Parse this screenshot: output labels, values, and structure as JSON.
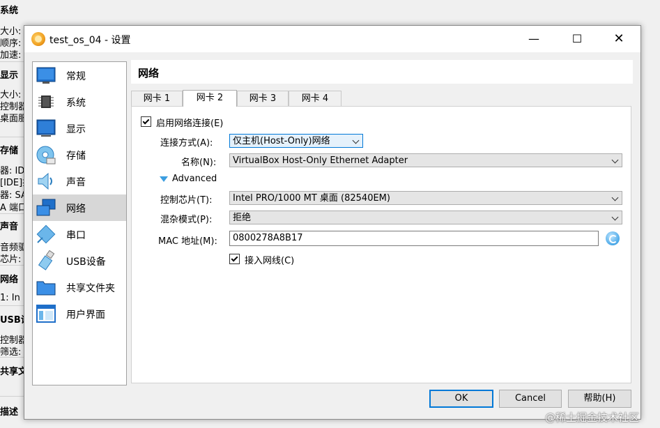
{
  "background_window": {
    "lines": [
      {
        "text": "系统",
        "bold": true
      },
      {
        "text": "大小:",
        "bold": false
      },
      {
        "text": "顺序:",
        "bold": false
      },
      {
        "text": "加速:",
        "bold": false
      },
      {
        "text": "显示",
        "bold": true
      },
      {
        "text": "大小:",
        "bold": false
      },
      {
        "text": "控制器",
        "bold": false
      },
      {
        "text": "桌面服",
        "bold": false
      },
      {
        "text": "存储",
        "bold": true
      },
      {
        "text": "器: ID",
        "bold": false
      },
      {
        "text": "[IDE]控",
        "bold": false
      },
      {
        "text": "器: SA",
        "bold": false
      },
      {
        "text": "A 端口",
        "bold": false
      },
      {
        "text": "声音",
        "bold": true
      },
      {
        "text": "音频驱",
        "bold": false
      },
      {
        "text": "芯片:",
        "bold": false
      },
      {
        "text": "网络",
        "bold": true
      },
      {
        "text": "1: In",
        "bold": false
      },
      {
        "text": "USB设",
        "bold": true
      },
      {
        "text": "控制器",
        "bold": false
      },
      {
        "text": "筛选:",
        "bold": false
      },
      {
        "text": "共享文",
        "bold": true
      },
      {
        "text": "描述",
        "bold": true
      }
    ]
  },
  "window": {
    "title": "test_os_04 - 设置",
    "minimize": "—",
    "maximize": "☐",
    "close": "✕"
  },
  "sidebar": {
    "items": [
      {
        "label": "常规",
        "icon": "general-icon"
      },
      {
        "label": "系统",
        "icon": "system-icon"
      },
      {
        "label": "显示",
        "icon": "display-icon"
      },
      {
        "label": "存储",
        "icon": "storage-icon"
      },
      {
        "label": "声音",
        "icon": "audio-icon"
      },
      {
        "label": "网络",
        "icon": "network-icon",
        "selected": true
      },
      {
        "label": "串口",
        "icon": "serial-port-icon"
      },
      {
        "label": "USB设备",
        "icon": "usb-icon"
      },
      {
        "label": "共享文件夹",
        "icon": "shared-folder-icon"
      },
      {
        "label": "用户界面",
        "icon": "user-interface-icon"
      }
    ]
  },
  "page": {
    "header": "网络",
    "tabs": [
      "网卡 1",
      "网卡 2",
      "网卡 3",
      "网卡 4"
    ],
    "active_tab": 1
  },
  "form": {
    "enable_label": "启用网络连接(E)",
    "enable_checked": true,
    "attached_label": "连接方式(A):",
    "attached_value": "仅主机(Host-Only)网络",
    "name_label": "名称(N):",
    "name_value": "VirtualBox Host-Only Ethernet Adapter",
    "advanced_label": "Advanced",
    "adapter_label": "控制芯片(T):",
    "adapter_value": "Intel PRO/1000 MT 桌面 (82540EM)",
    "promisc_label": "混杂模式(P):",
    "promisc_value": "拒绝",
    "mac_label": "MAC 地址(M):",
    "mac_value": "0800278A8B17",
    "cable_label": "接入网线(C)",
    "cable_checked": true
  },
  "buttons": {
    "ok": "OK",
    "cancel": "Cancel",
    "help": "帮助(H)"
  },
  "watermark": "@稀土掘金技术社区",
  "colors": {
    "accent": "#0078d7",
    "selected_item": "#d7d7d7",
    "window_bg": "#f0f0f0"
  }
}
